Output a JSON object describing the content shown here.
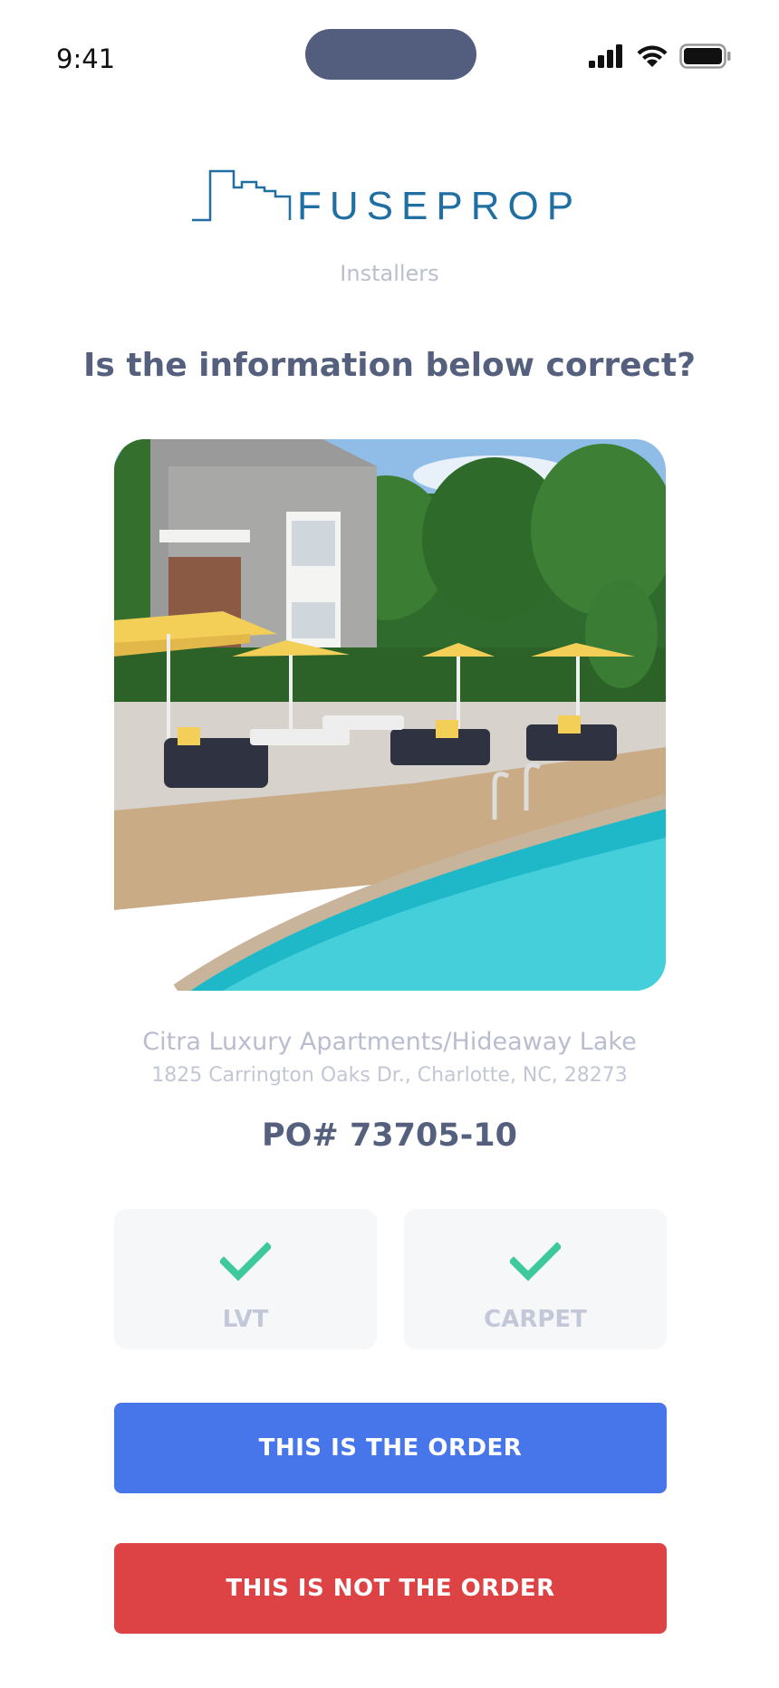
{
  "status_bar": {
    "time": "9:41",
    "icons": [
      "signal-icon",
      "wifi-icon",
      "battery-icon"
    ]
  },
  "brand": {
    "name": "FUSEPROP",
    "color": "#1f6fa3",
    "icon": "city-skyline-icon"
  },
  "header": {
    "subtitle": "Installers",
    "question": "Is the information below correct?"
  },
  "property": {
    "image": "pool-photo",
    "name": "Citra Luxury Apartments/Hideaway Lake",
    "address": "1825 Carrington Oaks Dr., Charlotte, NC, 28273",
    "po": "PO# 73705-10"
  },
  "materials": [
    {
      "label": "LVT",
      "checked": true,
      "icon": "checkmark-icon"
    },
    {
      "label": "CARPET",
      "checked": true,
      "icon": "checkmark-icon"
    }
  ],
  "actions": {
    "confirm_label": "THIS IS THE ORDER",
    "reject_label": "THIS IS NOT THE ORDER"
  },
  "colors": {
    "accent_blue": "#4776ea",
    "danger_red": "#dd4345",
    "check_green": "#3ec99a",
    "heading": "#54607d"
  }
}
